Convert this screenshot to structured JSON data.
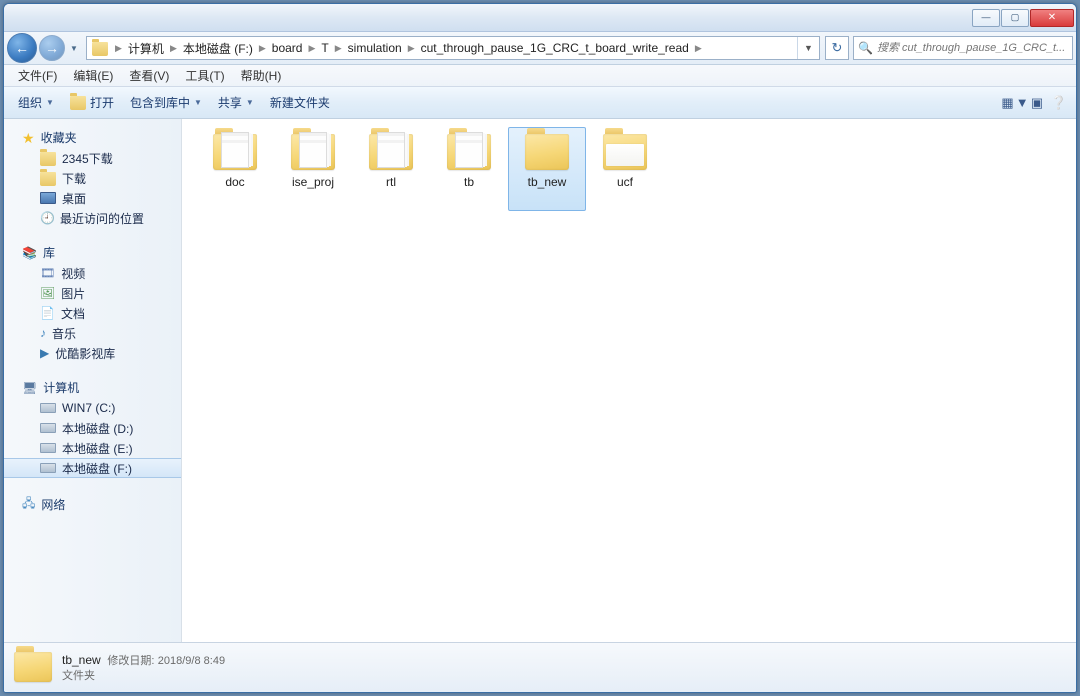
{
  "titlebar": {
    "min": "—",
    "max": "▢",
    "close": "✕"
  },
  "nav": {
    "back": "←",
    "fwd": "→",
    "drop": "▼",
    "refresh": "↻"
  },
  "breadcrumb": [
    "计算机",
    "本地磁盘 (F:)",
    "board",
    "T",
    "simulation",
    "cut_through_pause_1G_CRC_t_board_write_read"
  ],
  "search": {
    "placeholder": "搜索 cut_through_pause_1G_CRC_t..."
  },
  "menu": [
    "文件(F)",
    "编辑(E)",
    "查看(V)",
    "工具(T)",
    "帮助(H)"
  ],
  "toolbar": {
    "organize": "组织",
    "open": "打开",
    "include": "包含到库中",
    "share": "共享",
    "newfolder": "新建文件夹"
  },
  "sidebar": {
    "favorites": {
      "label": "收藏夹",
      "items": [
        "2345下载",
        "下载",
        "桌面",
        "最近访问的位置"
      ]
    },
    "libraries": {
      "label": "库",
      "items": [
        "视频",
        "图片",
        "文档",
        "音乐",
        "优酷影视库"
      ]
    },
    "computer": {
      "label": "计算机",
      "items": [
        "WIN7 (C:)",
        "本地磁盘 (D:)",
        "本地磁盘 (E:)",
        "本地磁盘 (F:)"
      ],
      "selectedIndex": 3
    },
    "network": {
      "label": "网络"
    }
  },
  "files": {
    "items": [
      {
        "name": "doc",
        "type": "docs"
      },
      {
        "name": "ise_proj",
        "type": "docs"
      },
      {
        "name": "rtl",
        "type": "docs"
      },
      {
        "name": "tb",
        "type": "docs"
      },
      {
        "name": "tb_new",
        "type": "folder",
        "selected": true
      },
      {
        "name": "ucf",
        "type": "open"
      }
    ]
  },
  "status": {
    "name": "tb_new",
    "date_label": "修改日期:",
    "date": "2018/9/8 8:49",
    "kind": "文件夹"
  }
}
